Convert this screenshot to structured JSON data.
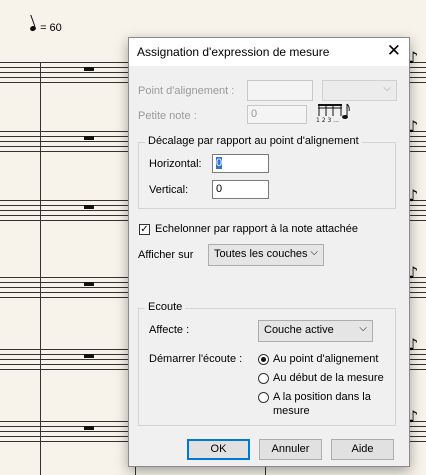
{
  "score": {
    "tempo_text": "= 60",
    "rest_icon": "whole-rest-icon",
    "note_icon": "eighth-note-icon"
  },
  "dialog": {
    "title": "Assignation d'expression de mesure",
    "close_icon": "close-icon",
    "alignment_point_label": "Point d'alignement :",
    "alignment_point_value": "",
    "alignment_point_select": "",
    "grace_note_label": "Petite note :",
    "grace_note_value": "0",
    "grace_note_icon": "tuplet-notes-icon",
    "grace_note_digits": "1 2 3 ...",
    "offset_group_label": "Décalage par rapport au point d'alignement",
    "horizontal_label": "Horizontal:",
    "horizontal_value": "0",
    "vertical_label": "Vertical:",
    "vertical_value": "0",
    "stagger_label": "Echelonner par rapport à la note attachée",
    "stagger_checked": true,
    "show_on_label": "Afficher sur",
    "show_on_value": "Toutes les couches",
    "playback_group_label": "Ecoute",
    "affects_label": "Affecte :",
    "affects_value": "Couche active",
    "start_playback_label": "Démarrer l'écoute :",
    "radio_options": [
      {
        "label": "Au point d'alignement",
        "selected": true
      },
      {
        "label": "Au début de la mesure",
        "selected": false
      },
      {
        "label": "A la position dans la",
        "label2": "mesure",
        "selected": false
      }
    ],
    "ok_label": "OK",
    "cancel_label": "Annuler",
    "help_label": "Aide",
    "accent_color": "#0078d7"
  }
}
